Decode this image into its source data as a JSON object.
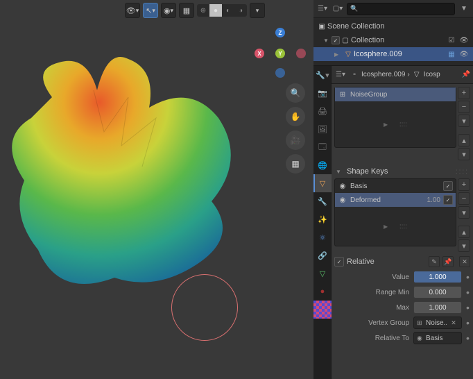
{
  "outliner": {
    "scene_collection": "Scene Collection",
    "collection": "Collection",
    "object": "Icosphere.009"
  },
  "breadcrumb": {
    "object": "Icosphere.009",
    "mesh_prefix": "Icosp"
  },
  "vertex_groups": {
    "item": "NoiseGroup"
  },
  "shape_keys": {
    "header": "Shape Keys",
    "basis": "Basis",
    "deformed": "Deformed",
    "deformed_value": "1.00",
    "relative_label": "Relative",
    "value_label": "Value",
    "value": "1.000",
    "range_min_label": "Range Min",
    "range_min": "0.000",
    "max_label": "Max",
    "max": "1.000",
    "vertex_group_label": "Vertex Group",
    "vertex_group": "Noise..",
    "relative_to_label": "Relative To",
    "relative_to": "Basis"
  },
  "gizmo": {
    "x": "X",
    "y": "Y",
    "z": "Z"
  }
}
